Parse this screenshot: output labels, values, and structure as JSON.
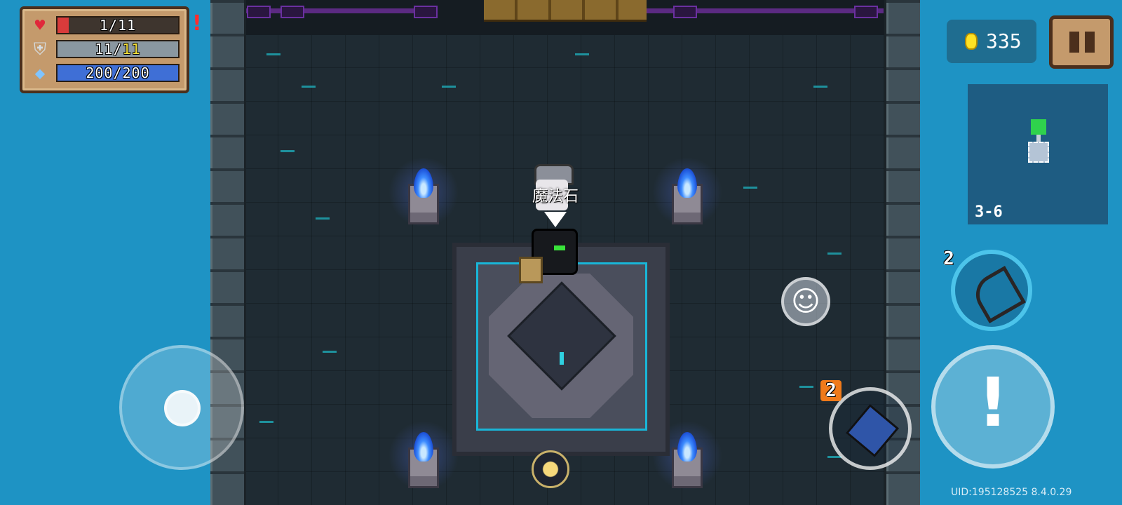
{
  "status": {
    "hp": {
      "text": "1/11",
      "fill": 0.0909,
      "color": "#d93b3b"
    },
    "armor": {
      "current": "11",
      "max": "11",
      "fill": 1.0,
      "color": "#8a97a0"
    },
    "energy": {
      "text": "200/200",
      "fill": 1.0,
      "color": "#3f6fd6"
    },
    "alert": "!",
    "icons": {
      "hp": "heart-icon",
      "armor": "shield-icon",
      "energy": "diamond-icon"
    }
  },
  "coins": {
    "count": "335",
    "icon": "coin-icon"
  },
  "pause": {
    "icon": "pause-icon"
  },
  "minimap": {
    "level": "3-6"
  },
  "character": {
    "tag": "魔法石"
  },
  "weapon_switch": {
    "ammo": "2",
    "icon": "bow-icon"
  },
  "skill": {
    "charges": "2",
    "icon": "gauntlet-icon"
  },
  "attack": {
    "glyph": "!",
    "icon": "attack-icon"
  },
  "emote": {
    "glyph": "☺",
    "icon": "smile-icon"
  },
  "joystick": {
    "icon": "joystick-icon"
  },
  "uid": "UID:195128525 8.4.0.29",
  "colors": {
    "background": "#1e93c4",
    "panel": "#c49a6c",
    "flame": "#3d8cff",
    "accent": "#19b6d8"
  }
}
